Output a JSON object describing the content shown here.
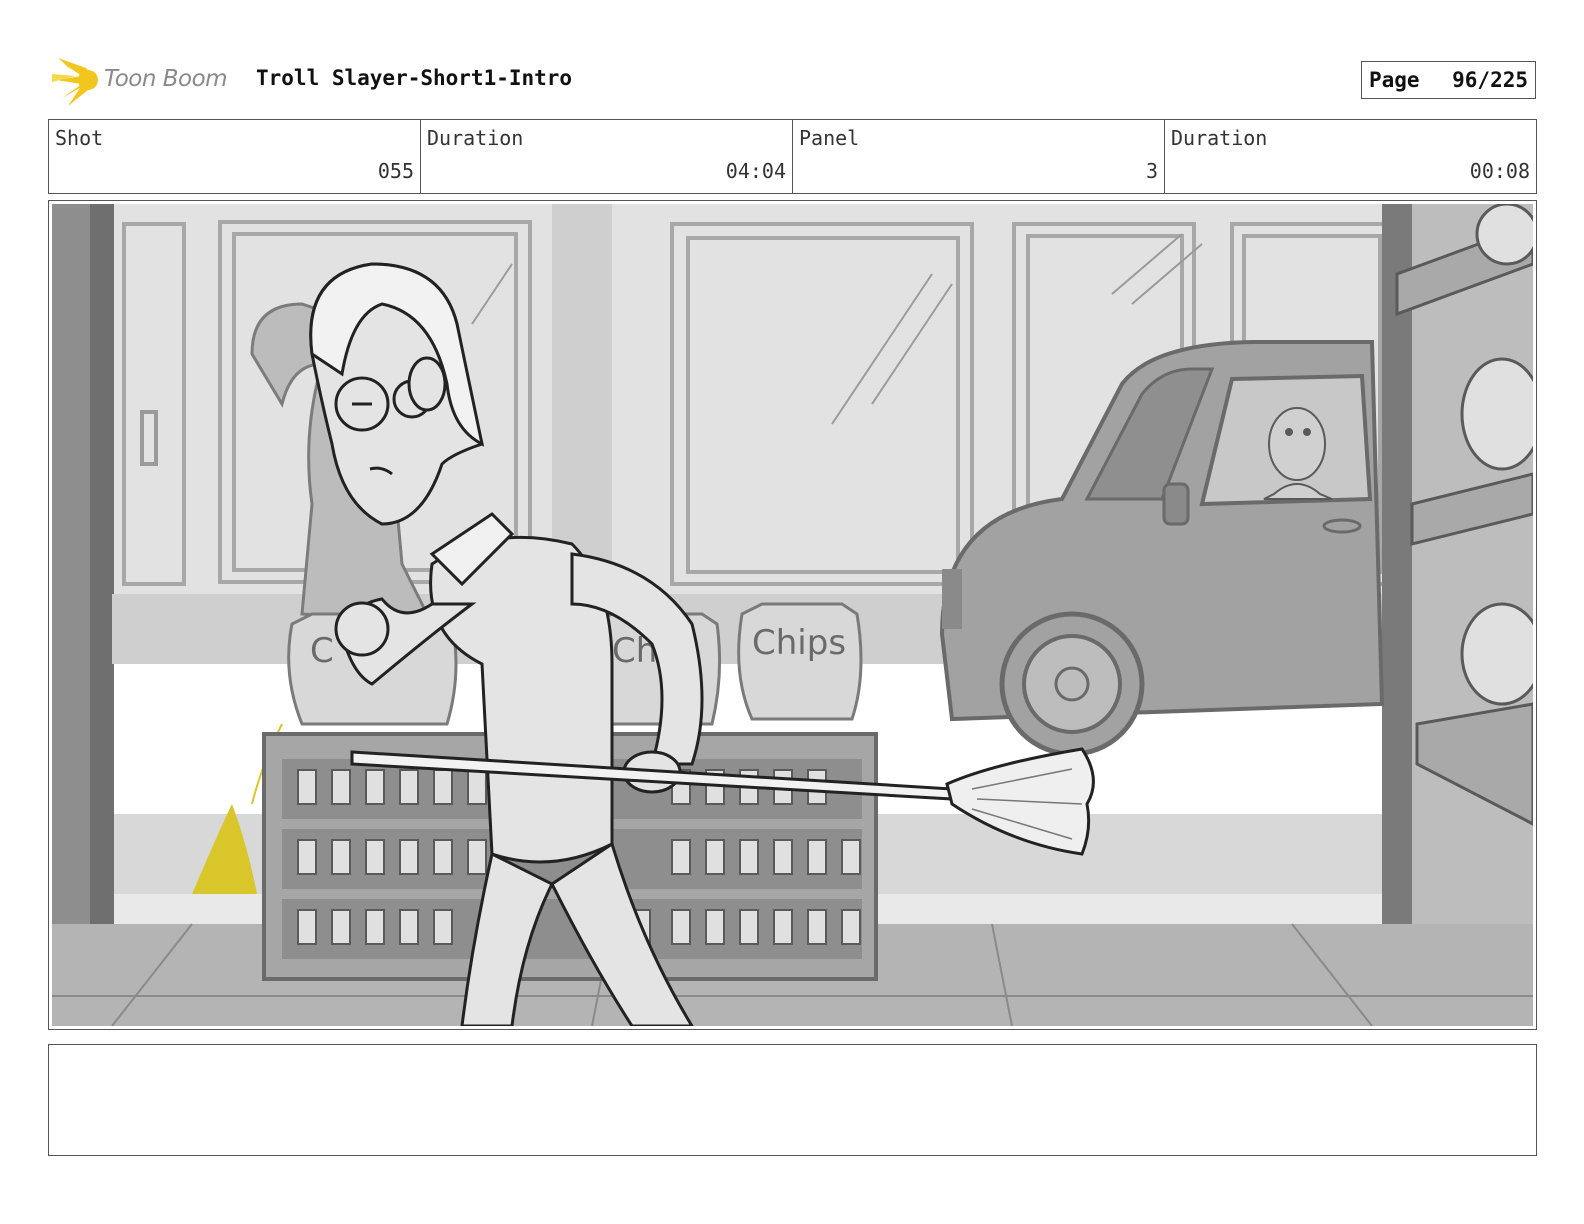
{
  "header": {
    "logo_text": "Toon Boom",
    "title": "Troll Slayer-Short1-Intro",
    "page_label": "Page",
    "page_value": "96/225"
  },
  "info": {
    "shot_label": "Shot",
    "shot_value": "055",
    "shot_duration_label": "Duration",
    "shot_duration_value": "04:04",
    "panel_label": "Panel",
    "panel_value": "3",
    "panel_duration_label": "Duration",
    "panel_duration_value": "00:08"
  },
  "panel": {
    "bag_text_front": "Chips",
    "bag_text_middle": "Chi",
    "bag_text_left": "C"
  },
  "notes": {
    "text": ""
  },
  "colors": {
    "logo_yellow": "#f3c61f",
    "spill_yellow": "#d9c62a",
    "frame_border": "#555555"
  }
}
